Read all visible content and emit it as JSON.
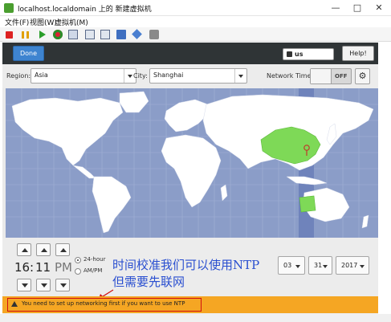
{
  "window": {
    "title": "localhost.localdomain 上的 新建虚拟机",
    "controls": [
      "—",
      "□",
      "✕"
    ]
  },
  "menu": [
    "文件(F)",
    "视图(W)",
    "虚拟机(M)"
  ],
  "toolbar": {
    "icons": [
      "stop-icon",
      "pause-icon",
      "play-icon",
      "refresh-icon",
      "fullscreen-icon",
      "snapshot-icon",
      "snapshot-manager-icon",
      "send-key-icon",
      "usb-icon",
      "settings-icon"
    ]
  },
  "installer": {
    "done_label": "Done",
    "keyboard_layout": "us",
    "help_label": "Help!",
    "region_label": "Region:",
    "region_value": "Asia",
    "city_label": "City:",
    "city_value": "Shanghai",
    "network_time_label": "Network Time",
    "network_time_state": "OFF",
    "highlighted_country_color": "#7ed957",
    "map_ocean_color": "#8b9dc8",
    "map_land_color": "#ffffff",
    "timezone_band_color": "#6f83bb"
  },
  "time": {
    "hour": "16",
    "colon": ":",
    "minute": "11",
    "ampm": "PM",
    "format_24h_label": "24-hour",
    "format_ampm_label": "AM/PM",
    "format_selected": "24-hour"
  },
  "date": {
    "month": "03",
    "day": "31",
    "year": "2017"
  },
  "annotation": {
    "line1": "时间校准我们可以使用NTP",
    "line2": "但需要先联网",
    "color": "#2a4fd0"
  },
  "warning": {
    "text": "You need to set up networking first if you want to use NTP",
    "bar_color": "#f5a623"
  }
}
